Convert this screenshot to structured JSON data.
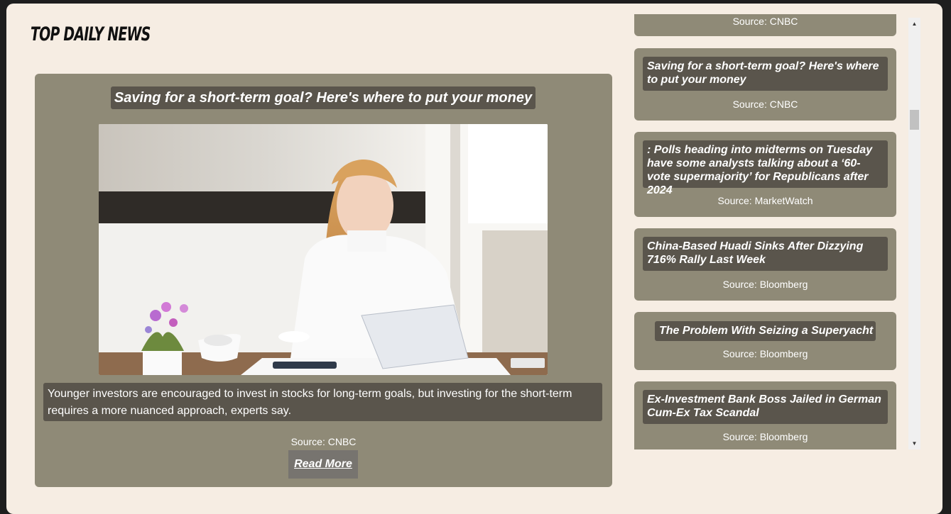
{
  "header": {
    "title": "TOP DAILY NEWS"
  },
  "featured": {
    "title": "Saving for a short-term goal? Here's where to put your money",
    "description": "Younger investors are encouraged to invest in stocks for long-term goals, but investing for the short-term requires a more nuanced approach, experts say.",
    "source": "Source: CNBC",
    "read_more": "Read More"
  },
  "sidebar": {
    "items": [
      {
        "title": "",
        "source": "Source: CNBC"
      },
      {
        "title": "Saving for a short-term goal? Here's where to put your money",
        "source": "Source: CNBC"
      },
      {
        "title": ": Polls heading into midterms on Tuesday have some analysts talking about a ‘60-vote supermajority’ for Republicans after 2024",
        "source": "Source: MarketWatch"
      },
      {
        "title": "China-Based Huadi Sinks After Dizzying 716% Rally Last Week",
        "source": "Source: Bloomberg"
      },
      {
        "title": "The Problem With Seizing a Superyacht",
        "source": "Source: Bloomberg"
      },
      {
        "title": "Ex-Investment Bank Boss Jailed in German Cum-Ex Tax Scandal",
        "source": "Source: Bloomberg"
      }
    ]
  },
  "colors": {
    "card": "#8f8a77",
    "label_bg": "#5a554c",
    "page_bg": "#f6ede3",
    "outer_bg": "#1e1e1e"
  }
}
